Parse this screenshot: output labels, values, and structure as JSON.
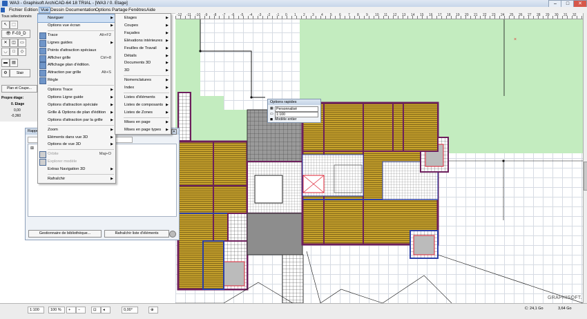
{
  "window": {
    "title": "WA3 - Graphisoft ArchiCAD-64 18 TRIAL - [WA3 / 0. Etage]"
  },
  "menubar": [
    "Fichier",
    "Edition",
    "Vue",
    "Dessin",
    "Documentation",
    "Options",
    "Partage",
    "Fenêtres",
    "Aide"
  ],
  "left_palette": {
    "header": "Tous sélectionnés",
    "stairs_label": "Stair",
    "plan_button": "Plan et Coupe...",
    "floor_label": "Propre étage:",
    "floor_value": "0. Etage",
    "elev_1": "0,00",
    "elev_2": "-0,360"
  },
  "vue_menu": [
    {
      "label": "Naviguer",
      "arrow": true,
      "highlight": true,
      "icon": false
    },
    {
      "label": "Options vue écran",
      "arrow": true,
      "icon": false
    },
    {
      "sep": true
    },
    {
      "label": "Trace",
      "shortcut": "Alt+F2",
      "icon": true
    },
    {
      "label": "Lignes guides",
      "arrow": true,
      "icon": true
    },
    {
      "label": "Points d'attraction spéciaux",
      "icon": true
    },
    {
      "label": "Afficher grille",
      "shortcut": "Ctrl+8",
      "icon": true
    },
    {
      "label": "Affichage plan d'édition.",
      "icon": true
    },
    {
      "label": "Attraction par grille",
      "shortcut": "Alt+S",
      "icon": true
    },
    {
      "label": "Règle",
      "icon": true
    },
    {
      "sep": true
    },
    {
      "label": "Options Trace",
      "arrow": true
    },
    {
      "label": "Options Ligne guide",
      "arrow": true
    },
    {
      "label": "Options d'attraction spéciale",
      "arrow": true
    },
    {
      "label": "Grille & Options de plan d'édition",
      "arrow": true
    },
    {
      "label": "Options d'attraction par la grille",
      "arrow": true
    },
    {
      "sep": true
    },
    {
      "label": "Zoom",
      "arrow": true
    },
    {
      "label": "Eléments dans vue 3D",
      "arrow": true
    },
    {
      "label": "Options de vue 3D",
      "arrow": true
    },
    {
      "sep": true
    },
    {
      "label": "Orbite",
      "shortcut": "Maj+O",
      "disabled": true,
      "icon": true
    },
    {
      "label": "Explorer modèle",
      "disabled": true,
      "icon": true
    },
    {
      "label": "Extras Navigation 3D",
      "arrow": true
    },
    {
      "sep": true
    },
    {
      "label": "Rafraîchir",
      "arrow": true
    }
  ],
  "naviguer_submenu": [
    {
      "label": "Etages",
      "arrow": true
    },
    {
      "label": "Coupes",
      "arrow": true
    },
    {
      "label": "Façades",
      "arrow": true
    },
    {
      "label": "Elévations intérieures",
      "arrow": true
    },
    {
      "label": "Feuilles de Travail",
      "arrow": true
    },
    {
      "label": "Détails",
      "arrow": true
    },
    {
      "label": "Documents 3D",
      "arrow": true
    },
    {
      "label": "3D",
      "arrow": true
    },
    {
      "sep": true
    },
    {
      "label": "Nomenclatures",
      "arrow": true
    },
    {
      "label": "Index",
      "arrow": true
    },
    {
      "sep": true
    },
    {
      "label": "Listes d'éléments",
      "arrow": true
    },
    {
      "label": "Listes de composants",
      "arrow": true
    },
    {
      "label": "Listes de Zones",
      "arrow": true
    },
    {
      "sep": true
    },
    {
      "label": "Mises en page",
      "arrow": true
    },
    {
      "label": "Mises en page types",
      "arrow": true
    }
  ],
  "rapport": {
    "title": "Rappo",
    "library_button": "Gestionnaire de bibliothèque...",
    "refresh_button": "Rafraîchir liste d'éléments"
  },
  "quick_options": {
    "title": "Options rapides",
    "rows": [
      "Personnalisé",
      "1:100",
      "Modèle entier"
    ]
  },
  "ruler": {
    "labels": [
      "-12",
      "-11",
      "-10",
      "-9",
      "-8",
      "-7",
      "-6",
      "-5",
      "-4",
      "-3",
      "-2",
      "-1",
      "0",
      "1",
      "2",
      "3",
      "4",
      "5",
      "6",
      "7",
      "8",
      "9",
      "10",
      "11",
      "12",
      "13",
      "14",
      "15",
      "16",
      "17",
      "18",
      "19",
      "20",
      "21",
      "22",
      "23",
      "24",
      "25",
      "26",
      "27",
      "28",
      "29",
      "30",
      "31",
      "32"
    ]
  },
  "statusbar": {
    "scale": "1:100",
    "zoom": "100 %",
    "angle": "0,00°",
    "disk_c": "C: 24,1 Go",
    "memory": "3,64 Go",
    "brand": "GRAPHISOFT."
  },
  "colors": {
    "landscape": "#c3ecbf",
    "wall": "#6d1f5c",
    "wall_blue": "#2b3fa8",
    "floor_hatch": "#c6a12c",
    "tiles": "#8c8c8c",
    "menu_highlight": "#cfe0f4"
  }
}
